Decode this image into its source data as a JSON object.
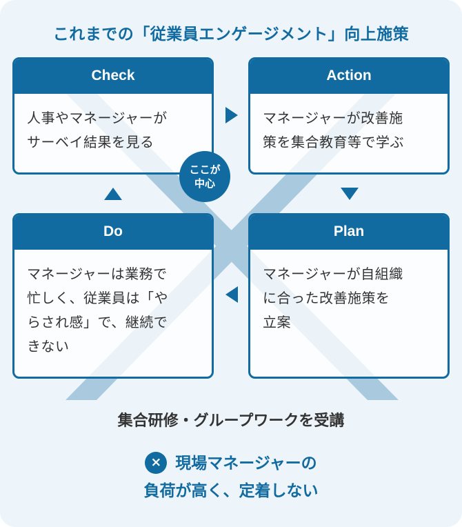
{
  "title": "これまでの「従業員エンゲージメント」向上施策",
  "cycle": {
    "check": {
      "heading": "Check",
      "body": "人事やマネージャーが\nサーベイ結果を見る"
    },
    "action": {
      "heading": "Action",
      "body": "マネージャーが改善施\n策を集合教育等で学ぶ"
    },
    "do": {
      "heading": "Do",
      "body": "マネージャーは業務で\n忙しく、従業員は「や\nらされ感」で、継続で\nきない"
    },
    "plan": {
      "heading": "Plan",
      "body": "マネージャーが自組織\nに合った改善施策を\n立案"
    },
    "center_badge": {
      "line1": "ここが",
      "line2": "中心"
    }
  },
  "method": "集合研修・グループワークを受講",
  "result": {
    "icon": "×",
    "line1": "現場マネージャーの",
    "line2": "負荷が高く、定着しない"
  },
  "colors": {
    "accent": "#116ba0",
    "background": "#eef5fa",
    "x_band": "#a9cade",
    "text": "#333333"
  }
}
